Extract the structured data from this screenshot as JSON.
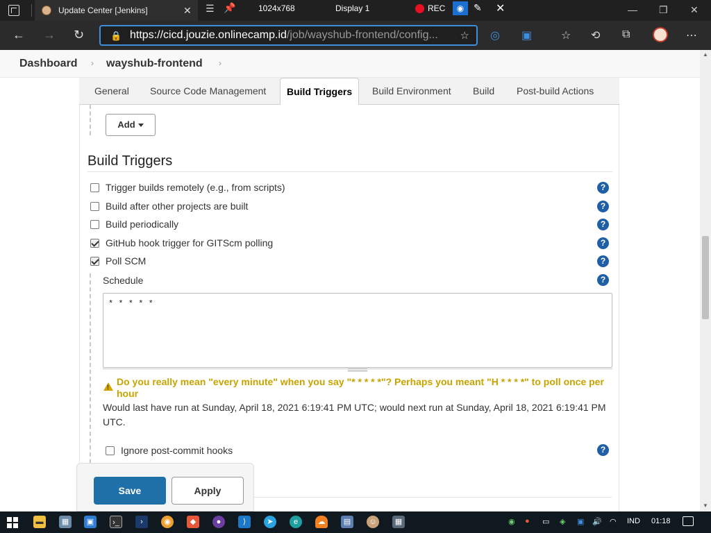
{
  "browser": {
    "tab_title": "Update Center [Jenkins]",
    "recorder": {
      "resolution": "1024x768",
      "display": "Display 1",
      "rec_label": "REC"
    },
    "url_main": "https://cicd.jouzie.onlinecamp.id",
    "url_rest": "/job/wayshub-frontend/config..."
  },
  "breadcrumb": {
    "items": [
      "Dashboard",
      "wayshub-frontend"
    ]
  },
  "tabs": [
    "General",
    "Source Code Management",
    "Build Triggers",
    "Build Environment",
    "Build",
    "Post-build Actions"
  ],
  "active_tab": "Build Triggers",
  "add_button": "Add",
  "section": {
    "title": "Build Triggers",
    "triggers": [
      {
        "label": "Trigger builds remotely (e.g., from scripts)",
        "checked": false
      },
      {
        "label": "Build after other projects are built",
        "checked": false
      },
      {
        "label": "Build periodically",
        "checked": false
      },
      {
        "label": "GitHub hook trigger for GITScm polling",
        "checked": true
      },
      {
        "label": "Poll SCM",
        "checked": true
      }
    ],
    "schedule_label": "Schedule",
    "schedule_value": "* * * * *",
    "warning": "Do you really mean \"every minute\" when you say \"* * * * *\"? Perhaps you meant \"H * * * *\" to poll once per hour",
    "info": "Would last have run at Sunday, April 18, 2021 6:19:41 PM UTC; would next run at Sunday, April 18, 2021 6:19:41 PM UTC.",
    "ignore_hooks": {
      "label": "Ignore post-commit hooks",
      "checked": false
    },
    "help_glyph": "?"
  },
  "buttons": {
    "save": "Save",
    "apply": "Apply"
  },
  "taskbar": {
    "lang": "IND",
    "time": "01:18"
  },
  "colors": {
    "primary": "#1f6fa8",
    "warning": "#c8a300",
    "help": "#1f5fa8"
  }
}
